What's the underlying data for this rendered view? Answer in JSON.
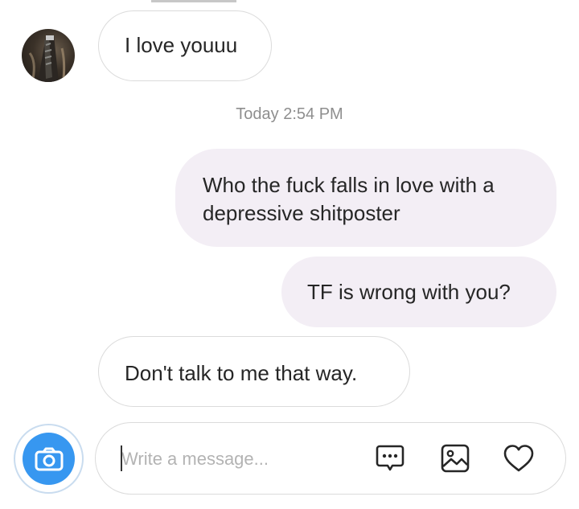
{
  "conversation": {
    "messages": [
      {
        "direction": "incoming",
        "text": "I love youuu"
      },
      {
        "direction": "outgoing",
        "text": "Who the fuck falls in love with a depressive shitposter"
      },
      {
        "direction": "outgoing",
        "text": "TF is wrong with you?"
      },
      {
        "direction": "incoming",
        "text": "Don't talk to me that way."
      }
    ],
    "timestamp": "Today 2:54 PM"
  },
  "composer": {
    "placeholder": "Write a message...",
    "value": ""
  },
  "icons": {
    "camera": "camera-icon",
    "sticker": "sticker-icon",
    "gallery": "gallery-icon",
    "like": "heart-icon"
  },
  "colors": {
    "accent": "#3797f0",
    "outgoing_bubble": "#f3eef5",
    "incoming_border": "#dbdbdb",
    "timestamp": "#8e8e8e"
  }
}
